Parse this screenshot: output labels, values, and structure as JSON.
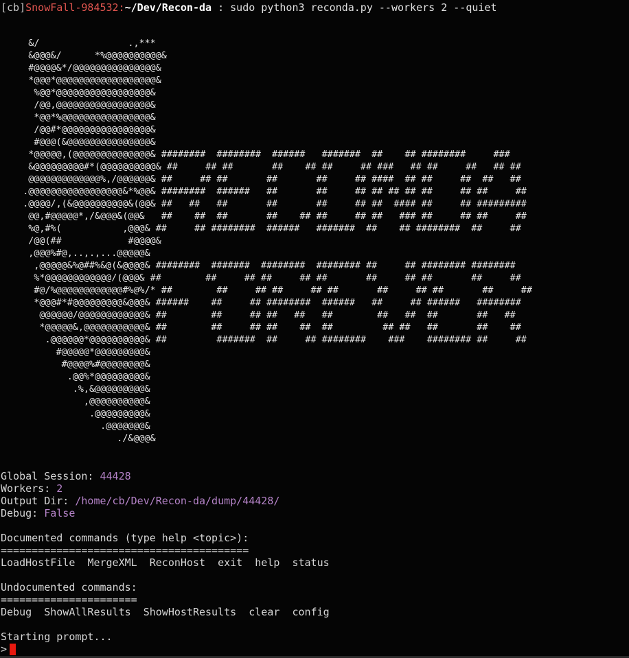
{
  "prompt": {
    "bracket_open": "[",
    "user": "cb",
    "bracket_close": "]",
    "host": "SnowFall-984532",
    "colon": ":",
    "path": "~/Dev/Recon-da",
    "command": " : sudo python3 reconda.py --workers 2 --quiet"
  },
  "banner": {
    "art": "     &/                .,***\n     &@@@&/      *%@@@@@@@@@@&\n     #@@@@&*/@@@@@@@@@@@@@@@&\n     *@@@*@@@@@@@@@@@@@@@@@@&\n      %@@*@@@@@@@@@@@@@@@@@&\n      /@@,@@@@@@@@@@@@@@@@@&\n      *@@*%@@@@@@@@@@@@@@@@&\n      /@@#*@@@@@@@@@@@@@@@@&\n      #@@@(&@@@@@@@@@@@@@@@&\n     *@@@@@,(@@@@@@@@@@@@@@& ########  ########  ######   #######  ##    ## ########     ###\n     &@@@@@@@@@#*(@@@@@@@@@@& ##     ## ##       ##    ## ##     ## ###   ## ##     ##   ## ##\n     @@@@@@@@@@@@@%,/@@@@@@& ##     ## ##       ##       ##     ## ####  ## ##     ##  ##   ##\n    .@@@@@@@@@@@@@@@@@&*%@@& ########  ######   ##       ##     ## ## ## ## ##     ## ##     ##\n    .@@@@/,(&@@@@@@@@@@&(@@& ##   ##   ##       ##       ##     ## ##  #### ##     ## #########\n     @@,#@@@@@*,/&@@@&(@@&   ##    ##  ##       ##    ## ##     ## ##   ### ##     ## ##     ##\n     %@,#%(           ,@@@& ##     ## ########  ######   #######  ##    ## ########  ##     ##\n     /@@(##            #@@@@&\n     ,@@@%#@,..,.,...@@@@@&\n      ,@@@@@&%@##%&@(&@@@@& ########  #######  ########  ######## ##     ## ######## ########\n      %*@@@@@@@@@@@@/(@@@& ##        ##     ## ##     ## ##       ##     ## ##       ##     ##\n      #@/%@@@@@@@@@@@@#%@%/* ##        ##     ## ##     ## ##       ##     ## ##       ##     ##\n      *@@@#*#@@@@@@@@@&@@@& ######    ##     ## ########  ######   ##     ## ######   ########\n       @@@@@@/@@@@@@@@@@@@& ##        ##     ## ##   ##   ##        ##   ##  ##       ##   ##\n       *@@@@@&,@@@@@@@@@@@& ##        ##     ## ##    ##  ##         ## ##   ##       ##    ##\n        .@@@@@@*@@@@@@@@@@& ##         #######  ##     ## ########    ###    ######## ##     ##\n          #@@@@@*@@@@@@@@@&\n           #@@@@%#@@@@@@@@&\n            .@@%*@@@@@@@@@&\n             .%,&@@@@@@@@@&\n               ,@@@@@@@@@@&\n                .@@@@@@@@@&\n                  .@@@@@@@&\n                     ./&@@@&"
  },
  "session": {
    "global_label": "Global Session: ",
    "global_value": "44428",
    "workers_label": "Workers: ",
    "workers_value": "2",
    "output_label": "Output Dir: ",
    "output_value": "/home/cb/Dev/Recon-da/dump/44428/",
    "debug_label": "Debug: ",
    "debug_value": "False"
  },
  "help": {
    "documented_header": "Documented commands (type help <topic>):",
    "documented_rule": "========================================",
    "documented_commands": [
      "LoadHostFile",
      "MergeXML",
      "ReconHost",
      "exit",
      "help",
      "status"
    ],
    "undocumented_header": "Undocumented commands:",
    "undocumented_rule": "======================",
    "undocumented_commands": [
      "Debug",
      "ShowAllResults",
      "ShowHostResults",
      "clear",
      "config"
    ]
  },
  "status": {
    "starting": "Starting prompt...",
    "prompt_symbol": ">"
  },
  "colors": {
    "background": "#050505",
    "text": "#d6d6d6",
    "host": "#e0554f",
    "value": "#b583c8",
    "cursor": "#e8190f"
  }
}
